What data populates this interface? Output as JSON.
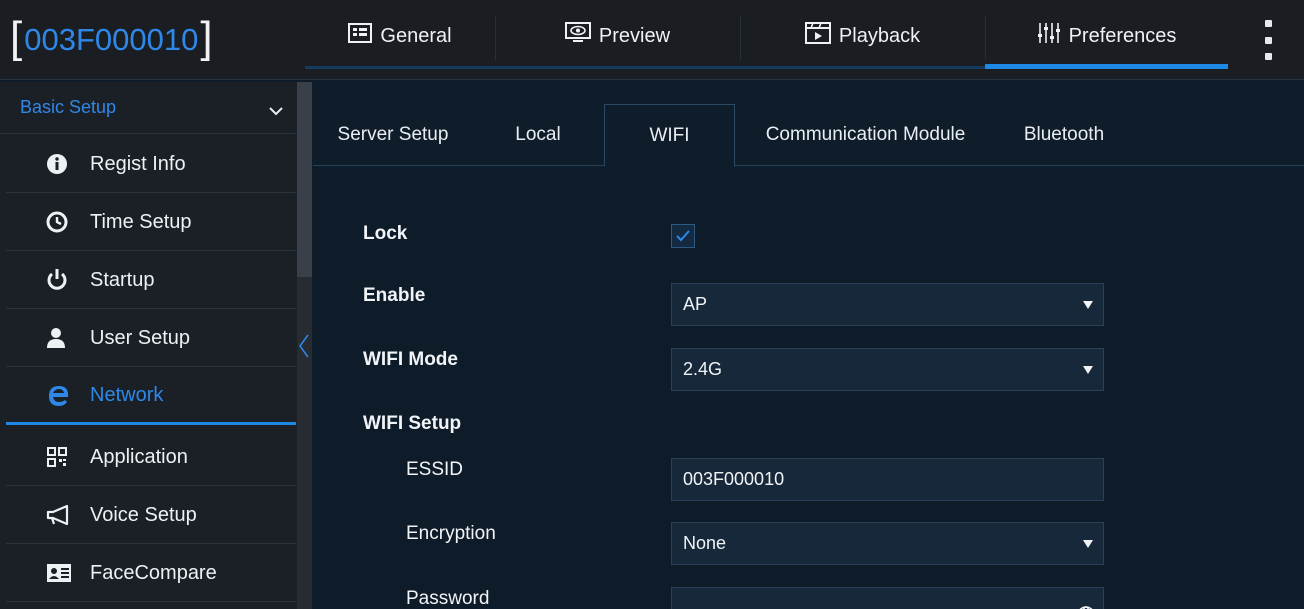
{
  "device": {
    "id": "003F000010"
  },
  "top_tabs": [
    {
      "label": "General",
      "icon": "general-grid-icon"
    },
    {
      "label": "Preview",
      "icon": "monitor-eye-icon"
    },
    {
      "label": "Playback",
      "icon": "film-play-icon"
    },
    {
      "label": "Preferences",
      "icon": "sliders-icon",
      "active": true
    }
  ],
  "sidebar": {
    "header": "Basic Setup",
    "items": [
      {
        "label": "Regist Info",
        "icon": "info-icon"
      },
      {
        "label": "Time Setup",
        "icon": "clock-icon"
      },
      {
        "label": "Startup",
        "icon": "power-icon"
      },
      {
        "label": "User Setup",
        "icon": "user-icon"
      },
      {
        "label": "Network",
        "icon": "ie-network-icon",
        "active": true
      },
      {
        "label": "Application",
        "icon": "qr-grid-icon"
      },
      {
        "label": "Voice Setup",
        "icon": "megaphone-icon"
      },
      {
        "label": "FaceCompare",
        "icon": "id-card-icon"
      }
    ]
  },
  "subtabs": [
    {
      "label": "Server Setup"
    },
    {
      "label": "Local"
    },
    {
      "label": "WIFI",
      "active": true
    },
    {
      "label": "Communication Module"
    },
    {
      "label": "Bluetooth"
    }
  ],
  "form": {
    "lock": {
      "label": "Lock",
      "checked": true
    },
    "enable": {
      "label": "Enable",
      "value": "AP"
    },
    "wifi_mode": {
      "label": "WIFI Mode",
      "value": "2.4G"
    },
    "wifi_setup": {
      "label": "WIFI Setup"
    },
    "essid": {
      "label": "ESSID",
      "value": "003F000010"
    },
    "encryption": {
      "label": "Encryption",
      "value": "None"
    },
    "password": {
      "label": "Password",
      "value": ""
    }
  },
  "colors": {
    "accent": "#1e88e5",
    "background": "#0f1c2a",
    "sidebar": "#1b2027",
    "topbar": "#1a1d22"
  }
}
